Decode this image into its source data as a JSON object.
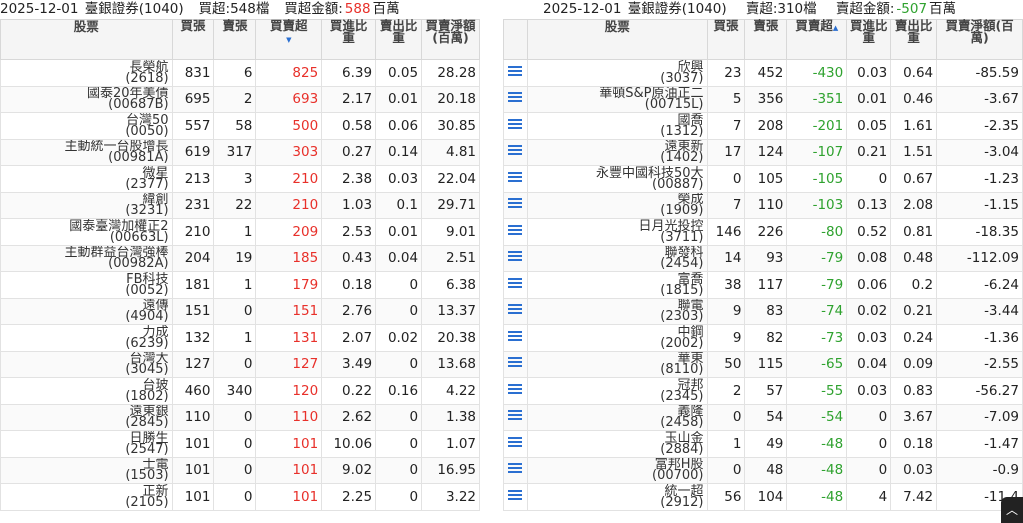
{
  "left": {
    "date": "2025-12-01",
    "broker": "臺銀證券(1040)",
    "summary_label": "買超:548檔",
    "amount_label": "買超金額:",
    "amount_value": "588",
    "amount_unit": "百萬",
    "headers": {
      "stock": "股票",
      "buy": "買張",
      "sell": "賣張",
      "net": "買賣超",
      "buy_ratio": "買進比重",
      "sell_ratio": "賣出比重",
      "amount": "買賣淨額(百萬)"
    },
    "rows": [
      {
        "name": "長榮航",
        "code": "(2618)",
        "buy": "831",
        "sell": "6",
        "net": "825",
        "br": "6.39",
        "sr": "0.05",
        "amt": "28.28"
      },
      {
        "name": "國泰20年美債",
        "code": "(00687B)",
        "buy": "695",
        "sell": "2",
        "net": "693",
        "br": "2.17",
        "sr": "0.01",
        "amt": "20.18"
      },
      {
        "name": "台灣50",
        "code": "(0050)",
        "buy": "557",
        "sell": "58",
        "net": "500",
        "br": "0.58",
        "sr": "0.06",
        "amt": "30.85"
      },
      {
        "name": "主動統一台股增長",
        "code": "(00981A)",
        "buy": "619",
        "sell": "317",
        "net": "303",
        "br": "0.27",
        "sr": "0.14",
        "amt": "4.81"
      },
      {
        "name": "微星",
        "code": "(2377)",
        "buy": "213",
        "sell": "3",
        "net": "210",
        "br": "2.38",
        "sr": "0.03",
        "amt": "22.04"
      },
      {
        "name": "緯創",
        "code": "(3231)",
        "buy": "231",
        "sell": "22",
        "net": "210",
        "br": "1.03",
        "sr": "0.1",
        "amt": "29.71"
      },
      {
        "name": "國泰臺灣加權正2",
        "code": "(00663L)",
        "buy": "210",
        "sell": "1",
        "net": "209",
        "br": "2.53",
        "sr": "0.01",
        "amt": "9.01"
      },
      {
        "name": "主動群益台灣強棒",
        "code": "(00982A)",
        "buy": "204",
        "sell": "19",
        "net": "185",
        "br": "0.43",
        "sr": "0.04",
        "amt": "2.51"
      },
      {
        "name": "FB科技",
        "code": "(0052)",
        "buy": "181",
        "sell": "1",
        "net": "179",
        "br": "0.18",
        "sr": "0",
        "amt": "6.38"
      },
      {
        "name": "遠傳",
        "code": "(4904)",
        "buy": "151",
        "sell": "0",
        "net": "151",
        "br": "2.76",
        "sr": "0",
        "amt": "13.37"
      },
      {
        "name": "力成",
        "code": "(6239)",
        "buy": "132",
        "sell": "1",
        "net": "131",
        "br": "2.07",
        "sr": "0.02",
        "amt": "20.38"
      },
      {
        "name": "台灣大",
        "code": "(3045)",
        "buy": "127",
        "sell": "0",
        "net": "127",
        "br": "3.49",
        "sr": "0",
        "amt": "13.68"
      },
      {
        "name": "台玻",
        "code": "(1802)",
        "buy": "460",
        "sell": "340",
        "net": "120",
        "br": "0.22",
        "sr": "0.16",
        "amt": "4.22"
      },
      {
        "name": "遠東銀",
        "code": "(2845)",
        "buy": "110",
        "sell": "0",
        "net": "110",
        "br": "2.62",
        "sr": "0",
        "amt": "1.38"
      },
      {
        "name": "日勝生",
        "code": "(2547)",
        "buy": "101",
        "sell": "0",
        "net": "101",
        "br": "10.06",
        "sr": "0",
        "amt": "1.07"
      },
      {
        "name": "士電",
        "code": "(1503)",
        "buy": "101",
        "sell": "0",
        "net": "101",
        "br": "9.02",
        "sr": "0",
        "amt": "16.95"
      },
      {
        "name": "正新",
        "code": "(2105)",
        "buy": "101",
        "sell": "0",
        "net": "101",
        "br": "2.25",
        "sr": "0",
        "amt": "3.22"
      }
    ]
  },
  "right": {
    "date": "2025-12-01",
    "broker": "臺銀證券(1040)",
    "summary_label": "賣超:310檔",
    "amount_label": "賣超金額:",
    "amount_value": "-507",
    "amount_unit": "百萬",
    "headers": {
      "stock": "股票",
      "buy": "買張",
      "sell": "賣張",
      "net": "買賣超",
      "buy_ratio": "買進比重",
      "sell_ratio": "賣出比重",
      "amount": "買賣淨額(百萬)"
    },
    "rows": [
      {
        "name": "欣興",
        "code": "(3037)",
        "buy": "23",
        "sell": "452",
        "net": "-430",
        "br": "0.03",
        "sr": "0.64",
        "amt": "-85.59"
      },
      {
        "name": "華頓S&P原油正二",
        "code": "(00715L)",
        "buy": "5",
        "sell": "356",
        "net": "-351",
        "br": "0.01",
        "sr": "0.46",
        "amt": "-3.67"
      },
      {
        "name": "國喬",
        "code": "(1312)",
        "buy": "7",
        "sell": "208",
        "net": "-201",
        "br": "0.05",
        "sr": "1.61",
        "amt": "-2.35"
      },
      {
        "name": "遠東新",
        "code": "(1402)",
        "buy": "17",
        "sell": "124",
        "net": "-107",
        "br": "0.21",
        "sr": "1.51",
        "amt": "-3.04"
      },
      {
        "name": "永豐中國科技50大",
        "code": "(00887)",
        "buy": "0",
        "sell": "105",
        "net": "-105",
        "br": "0",
        "sr": "0.67",
        "amt": "-1.23"
      },
      {
        "name": "榮成",
        "code": "(1909)",
        "buy": "7",
        "sell": "110",
        "net": "-103",
        "br": "0.13",
        "sr": "2.08",
        "amt": "-1.15"
      },
      {
        "name": "日月光投控",
        "code": "(3711)",
        "buy": "146",
        "sell": "226",
        "net": "-80",
        "br": "0.52",
        "sr": "0.81",
        "amt": "-18.35"
      },
      {
        "name": "聯發科",
        "code": "(2454)",
        "buy": "14",
        "sell": "93",
        "net": "-79",
        "br": "0.08",
        "sr": "0.48",
        "amt": "-112.09"
      },
      {
        "name": "富喬",
        "code": "(1815)",
        "buy": "38",
        "sell": "117",
        "net": "-79",
        "br": "0.06",
        "sr": "0.2",
        "amt": "-6.24"
      },
      {
        "name": "聯電",
        "code": "(2303)",
        "buy": "9",
        "sell": "83",
        "net": "-74",
        "br": "0.02",
        "sr": "0.21",
        "amt": "-3.44"
      },
      {
        "name": "中鋼",
        "code": "(2002)",
        "buy": "9",
        "sell": "82",
        "net": "-73",
        "br": "0.03",
        "sr": "0.24",
        "amt": "-1.36"
      },
      {
        "name": "華東",
        "code": "(8110)",
        "buy": "50",
        "sell": "115",
        "net": "-65",
        "br": "0.04",
        "sr": "0.09",
        "amt": "-2.55"
      },
      {
        "name": "冠邦",
        "code": "(2345)",
        "buy": "2",
        "sell": "57",
        "net": "-55",
        "br": "0.03",
        "sr": "0.83",
        "amt": "-56.27"
      },
      {
        "name": "義隆",
        "code": "(2458)",
        "buy": "0",
        "sell": "54",
        "net": "-54",
        "br": "0",
        "sr": "3.67",
        "amt": "-7.09"
      },
      {
        "name": "玉山金",
        "code": "(2884)",
        "buy": "1",
        "sell": "49",
        "net": "-48",
        "br": "0",
        "sr": "0.18",
        "amt": "-1.47"
      },
      {
        "name": "富邦H股",
        "code": "(00700)",
        "buy": "0",
        "sell": "48",
        "net": "-48",
        "br": "0",
        "sr": "0.03",
        "amt": "-0.9"
      },
      {
        "name": "統一超",
        "code": "(2912)",
        "buy": "56",
        "sell": "104",
        "net": "-48",
        "br": "4",
        "sr": "7.42",
        "amt": "-11.4"
      }
    ]
  },
  "colors": {
    "positive": "#e8302a",
    "negative": "#2fa22f",
    "accent": "#2a6fd1"
  },
  "icons": {
    "row_detail": "list-icon",
    "scroll_top": "chevron-up-icon"
  }
}
